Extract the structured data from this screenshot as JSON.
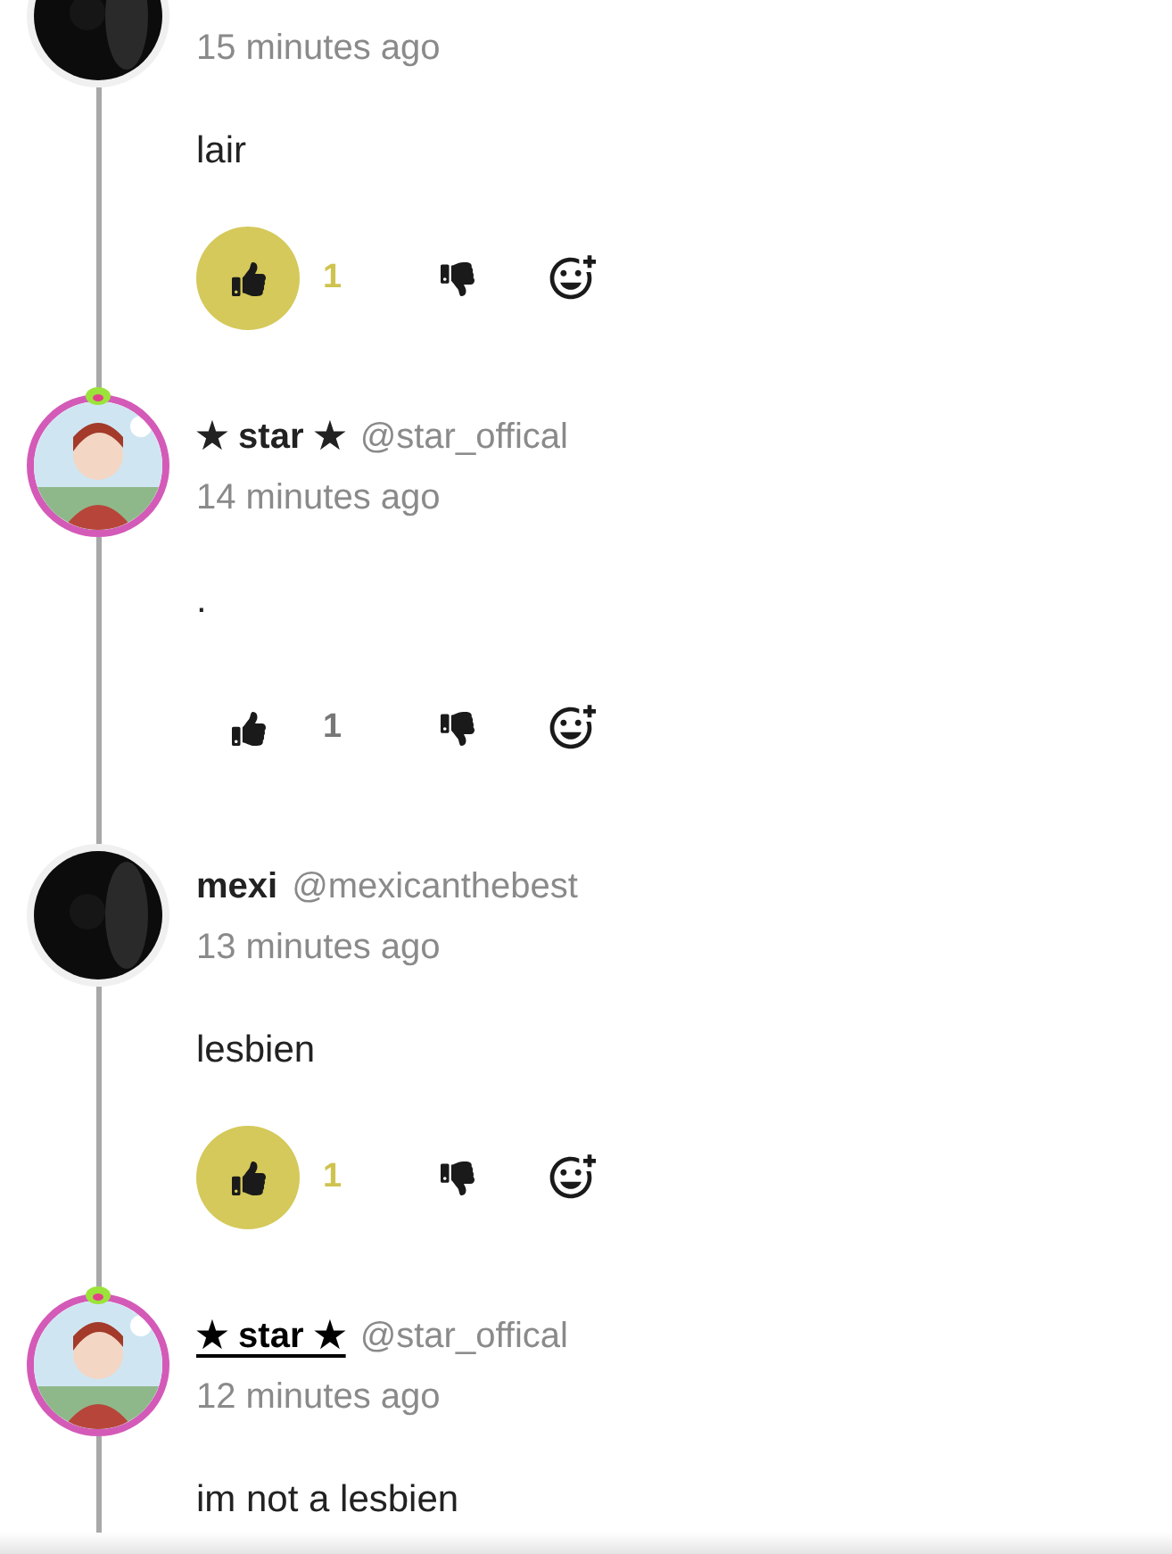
{
  "comments": [
    {
      "kind": "plain",
      "time": "15 minutes ago",
      "body": "lair",
      "like": {
        "selected": true,
        "count": "1"
      }
    },
    {
      "kind": "framed",
      "name": "★ star ★",
      "handle": "@star_offical",
      "underlined": false,
      "time": "14 minutes ago",
      "body": ".",
      "like": {
        "selected": false,
        "count": "1"
      }
    },
    {
      "kind": "plain",
      "name": "mexi",
      "handle": "@mexicanthebest",
      "underlined": false,
      "time": "13 minutes ago",
      "body": "lesbien",
      "like": {
        "selected": true,
        "count": "1"
      }
    },
    {
      "kind": "framed",
      "name": "★ star ★",
      "handle": "@star_offical",
      "underlined": true,
      "time": "12 minutes ago",
      "body": "im not a lesbien"
    }
  ]
}
